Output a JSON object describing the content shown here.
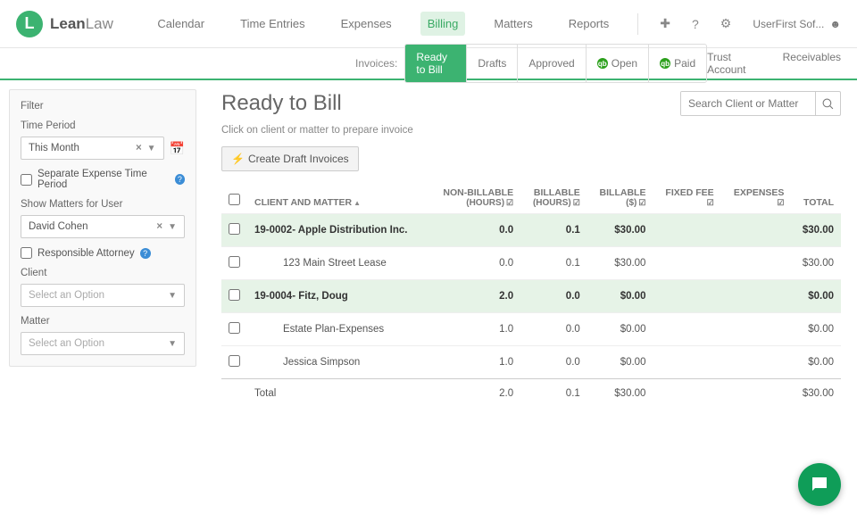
{
  "logo": {
    "initial": "L",
    "brand_a": "Lean",
    "brand_b": "Law"
  },
  "topnav": {
    "calendar": "Calendar",
    "time_entries": "Time Entries",
    "expenses": "Expenses",
    "billing": "Billing",
    "matters": "Matters",
    "reports": "Reports",
    "user": "UserFirst Sof..."
  },
  "subnav": {
    "label": "Invoices:",
    "tabs": {
      "ready": "Ready to Bill",
      "drafts": "Drafts",
      "approved": "Approved",
      "open": "Open",
      "paid": "Paid"
    },
    "trust": "Trust Account",
    "receivables": "Receivables"
  },
  "sidebar": {
    "filter": "Filter",
    "time_period": "Time Period",
    "time_period_value": "This Month",
    "separate_expense": "Separate Expense Time Period",
    "show_matters": "Show Matters for User",
    "user_value": "David Cohen",
    "responsible": "Responsible Attorney",
    "client": "Client",
    "matter": "Matter",
    "placeholder": "Select an Option"
  },
  "main": {
    "title": "Ready to Bill",
    "subtitle": "Click on client or matter to prepare invoice",
    "create_btn": "Create Draft Invoices",
    "search_placeholder": "Search Client or Matter"
  },
  "columns": {
    "client": "CLIENT AND MATTER",
    "nonbill": "NON-BILLABLE",
    "nonbill_sub": "(HOURS)",
    "bill_h": "BILLABLE",
    "bill_h_sub": "(HOURS)",
    "bill_d": "BILLABLE",
    "bill_d_sub": "($)",
    "fixed": "FIXED FEE",
    "expenses": "EXPENSES",
    "total": "TOTAL"
  },
  "rows": {
    "g1": {
      "name": "19-0002- Apple Distribution Inc.",
      "nb": "0.0",
      "bh": "0.1",
      "bd": "$30.00",
      "ff": "",
      "ex": "",
      "tot": "$30.00"
    },
    "r1": {
      "name": "123 Main Street Lease",
      "nb": "0.0",
      "bh": "0.1",
      "bd": "$30.00",
      "ff": "",
      "ex": "",
      "tot": "$30.00"
    },
    "g2": {
      "name": "19-0004- Fitz, Doug",
      "nb": "2.0",
      "bh": "0.0",
      "bd": "$0.00",
      "ff": "",
      "ex": "",
      "tot": "$0.00"
    },
    "r2": {
      "name": "Estate Plan-Expenses",
      "nb": "1.0",
      "bh": "0.0",
      "bd": "$0.00",
      "ff": "",
      "ex": "",
      "tot": "$0.00"
    },
    "r3": {
      "name": "Jessica Simpson",
      "nb": "1.0",
      "bh": "0.0",
      "bd": "$0.00",
      "ff": "",
      "ex": "",
      "tot": "$0.00"
    },
    "total": {
      "name": "Total",
      "nb": "2.0",
      "bh": "0.1",
      "bd": "$30.00",
      "ff": "",
      "ex": "",
      "tot": "$30.00"
    }
  }
}
